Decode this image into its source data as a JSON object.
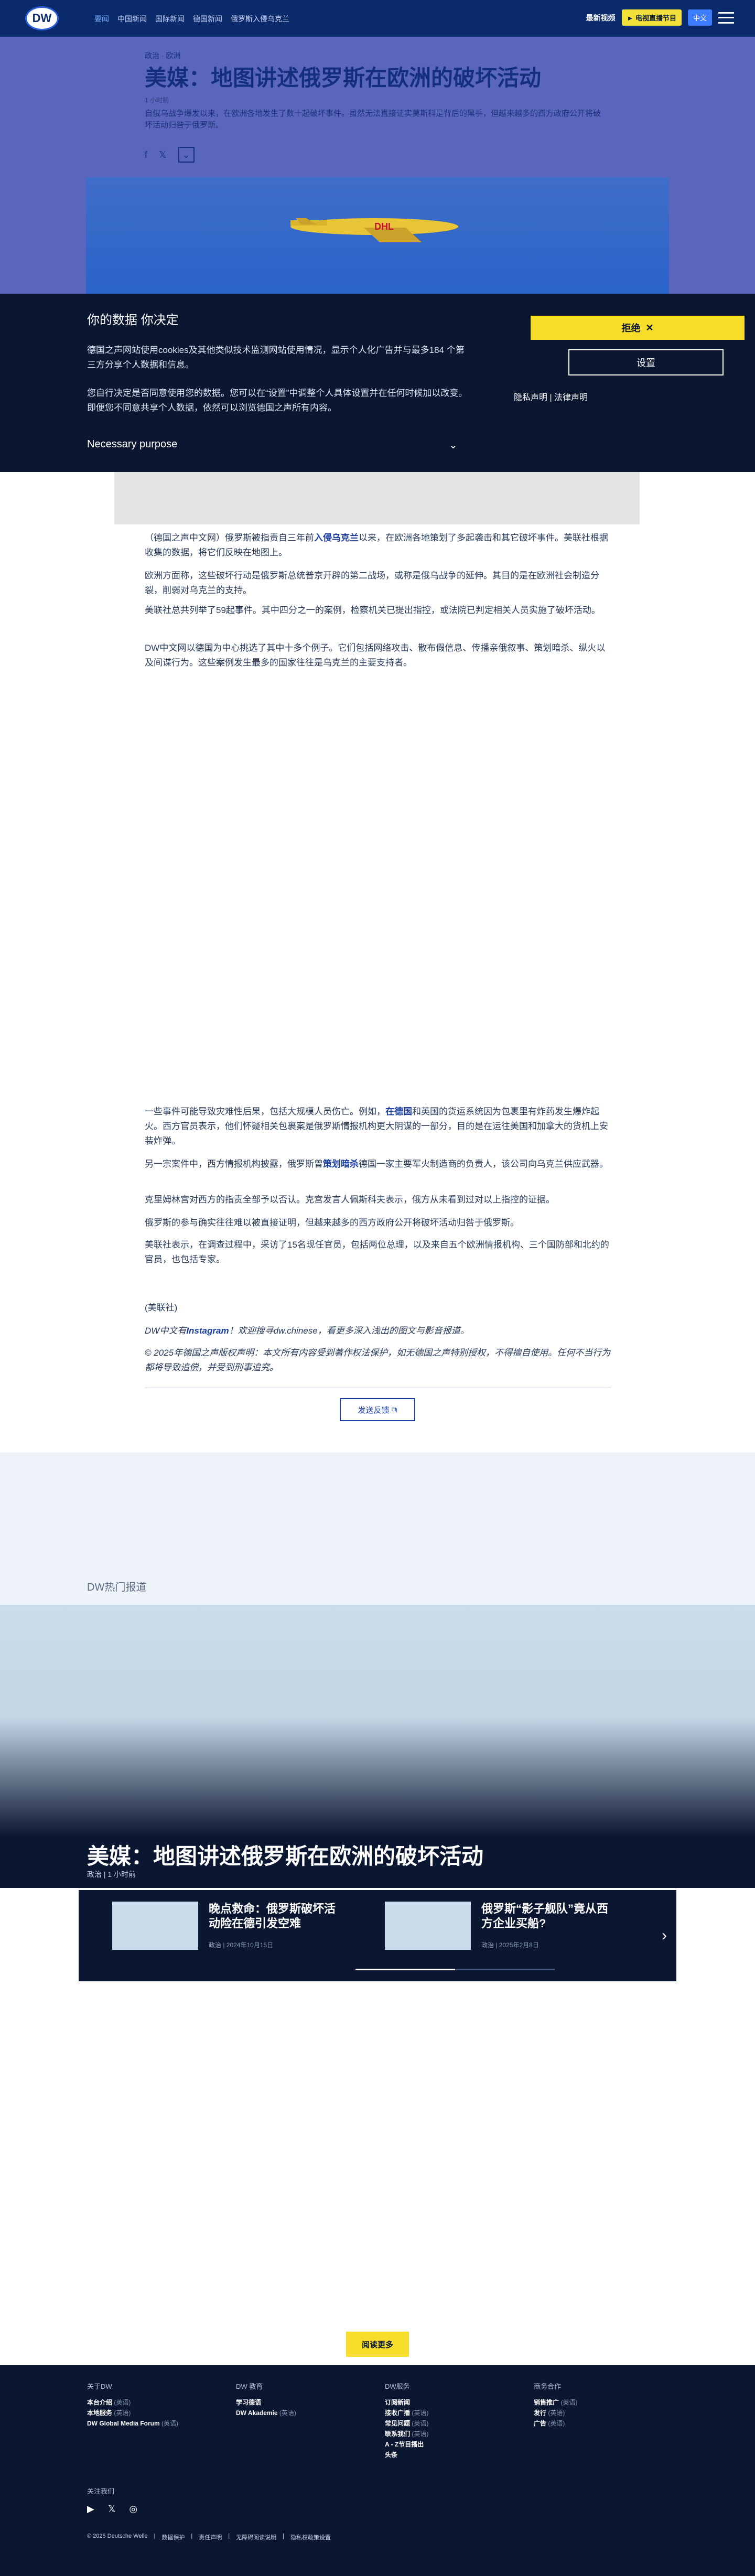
{
  "header": {
    "logo": "DW",
    "nav": [
      "要闻",
      "中国新闻",
      "国际新闻",
      "德国新闻",
      "俄罗斯入侵乌克兰"
    ],
    "live": "最新视频",
    "tv_button": "► 电视直播节目",
    "lang": "中文"
  },
  "article": {
    "breadcrumb": "政治 · 欧洲",
    "title": "美媒：地图讲述俄罗斯在欧洲的破坏活动",
    "time": "1 小时前",
    "lead": "自俄乌战争爆发以来，在欧洲各地发生了数十起破坏事件。虽然无法直接证实莫斯科是背后的黑手，但越来越多的西方政府公开将破坏活动归咎于俄罗斯。",
    "share_icons": [
      "facebook-icon",
      "x-icon",
      "more-icon"
    ],
    "image_text": "DHL"
  },
  "consent": {
    "title": "你的数据 你决定",
    "p1": "德国之声网站使用cookies及其他类似技术监测网站使用情况，显示个人化广告并与最多184 个第三方分享个人数据和信息。",
    "p2": "您自行决定是否同意使用您的数据。您可以在“设置”中调整个人具体设置并在任何时候加以改变。即便您不同意共享个人数据，依然可以浏览德国之声所有内容。",
    "purpose": "Necessary purpose",
    "reject": "拒绝",
    "settings": "设置",
    "privacy": "隐私声明 | 法律声明"
  },
  "body": {
    "p1_a": "（德国之声中文网）俄罗斯被指责自三年前",
    "p1_link": "入侵乌克兰",
    "p1_b": "以来，在欧洲各地策划了多起袭击和其它破坏事件。美联社根据收集的数据，将它们反映在地图上。",
    "p2": "欧洲方面称，这些破坏行动是俄罗斯总统普京开辟的第二战场，或称是俄乌战争的延伸。其目的是在欧洲社会制造分裂，削弱对乌克兰的支持。",
    "p3": "美联社总共列举了59起事件。其中四分之一的案例，检察机关已提出指控，或法院已判定相关人员实施了破坏活动。",
    "p4": "DW中文网以德国为中心挑选了其中十多个例子。它们包括网络攻击、散布假信息、传播亲俄叙事、策划暗杀、纵火以及间谍行为。这些案例发生最多的国家往往是乌克兰的主要支持者。",
    "p5_a": "一些事件可能导致灾难性后果，包括大规模人员伤亡。例如，",
    "p5_link": "在德国",
    "p5_b": "和英国的货运系统因为包裹里有炸药发生爆炸起火。西方官员表示，他们怀疑相关包裹案是俄罗斯情报机构更大阴谋的一部分，目的是在运往美国和加拿大的货机上安装炸弹。",
    "p6_a": "另一宗案件中，西方情报机构披露，俄罗斯曾",
    "p6_link": "策划暗杀",
    "p6_b": "德国一家主要军火制造商的负责人，该公司向乌克兰供应武器。",
    "p7": "克里姆林宫对西方的指责全部予以否认。克宫发言人佩斯科夫表示，俄方从未看到过对以上指控的证据。",
    "p8": "俄罗斯的参与确实往往难以被直接证明，但越来越多的西方政府公开将破坏活动归咎于俄罗斯。",
    "p9": "美联社表示，在调查过程中，采访了15名现任官员，包括两位总理，以及来自五个欧洲情报机构、三个国防部和北约的官员，也包括专家。",
    "source": "(美联社)",
    "ig_a": "DW中文有",
    "ig_link": "Instagram",
    "ig_b": "！欢迎搜寻dw.chinese，看更多深入浅出的图文与影音报道。",
    "copyright": "© 2025年德国之声版权声明：本文所有内容受到著作权法保护，如无德国之声特别授权，不得擅自使用。任何不当行为都将导致追偿，并受到刑事追究。",
    "feedback": "发送反馈"
  },
  "promo": {
    "section": "DW热门报道",
    "title": "美媒：地图讲述俄罗斯在欧洲的破坏活动",
    "meta": "政治 | 1 小时前",
    "cards": [
      {
        "title": "晚点救命：俄罗斯破坏活动险在德引发空难",
        "meta": "政治 | 2024年10月15日"
      },
      {
        "title": "俄罗斯“影子舰队”竟从西方企业买船?",
        "meta": "政治 | 2025年2月8日"
      }
    ]
  },
  "more_button": "阅读更多",
  "footer": {
    "cols": [
      {
        "h": "关于DW",
        "items": [
          [
            "本台介绍",
            "(英语)"
          ],
          [
            "本地服务",
            "(英语)"
          ],
          [
            "DW Global Media Forum",
            "(英语)"
          ]
        ]
      },
      {
        "h": "DW 教育",
        "items": [
          [
            "学习德语",
            ""
          ],
          [
            "DW Akademie",
            "(英语)"
          ]
        ]
      },
      {
        "h": "DW服务",
        "items": [
          [
            "订阅新闻",
            ""
          ],
          [
            "接收广播",
            "(英语)"
          ],
          [
            "常见问题",
            "(英语)"
          ],
          [
            "联系我们",
            "(英语)"
          ],
          [
            "A - Z节目播出",
            ""
          ],
          [
            "头条",
            ""
          ]
        ]
      },
      {
        "h": "商务合作",
        "items": [
          [
            "销售推广",
            "(英语)"
          ],
          [
            "发行",
            "(英语)"
          ],
          [
            "广告",
            "(英语)"
          ]
        ]
      }
    ],
    "follow": "关注我们",
    "social": [
      "youtube-icon",
      "x-icon",
      "instagram-icon"
    ],
    "legal": [
      "© 2025 Deutsche Welle",
      "数据保护",
      "责任声明",
      "无障碍阅读说明",
      "隐私权政策设置"
    ]
  }
}
